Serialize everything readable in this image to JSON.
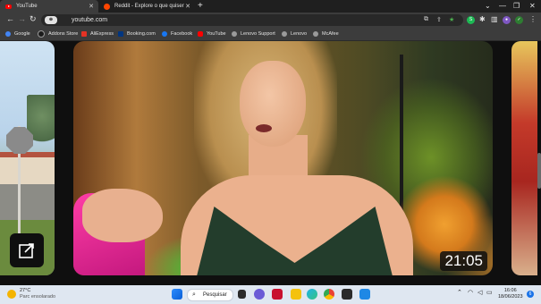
{
  "tabs": [
    {
      "title": "YouTube",
      "active": true,
      "icon": "youtube-icon"
    },
    {
      "title": "Reddit - Explore o que quiser",
      "active": false,
      "icon": "reddit-icon"
    }
  ],
  "toolbar": {
    "url": "youtube.com",
    "zoom_chip": "⊕"
  },
  "bookmarks": [
    {
      "label": "Google",
      "color": "#4285f4"
    },
    {
      "label": "Addons Store",
      "color": "#1b1b1b"
    },
    {
      "label": "AliExpress",
      "color": "#e43225"
    },
    {
      "label": "Booking.com",
      "color": "#003580"
    },
    {
      "label": "Facebook",
      "color": "#1877f2"
    },
    {
      "label": "YouTube",
      "color": "#ff0000"
    },
    {
      "label": "Lenovo Support",
      "color": "#9a9a9a"
    },
    {
      "label": "Lenovo",
      "color": "#9a9a9a"
    },
    {
      "label": "McAfee",
      "color": "#9a9a9a"
    }
  ],
  "video": {
    "duration": "21:05"
  },
  "taskbar": {
    "weather_temp": "27°C",
    "weather_desc": "Parc ensolarado",
    "search_label": "Pesquisar",
    "time": "16:06",
    "date": "18/06/2023",
    "notification_count": "6"
  }
}
